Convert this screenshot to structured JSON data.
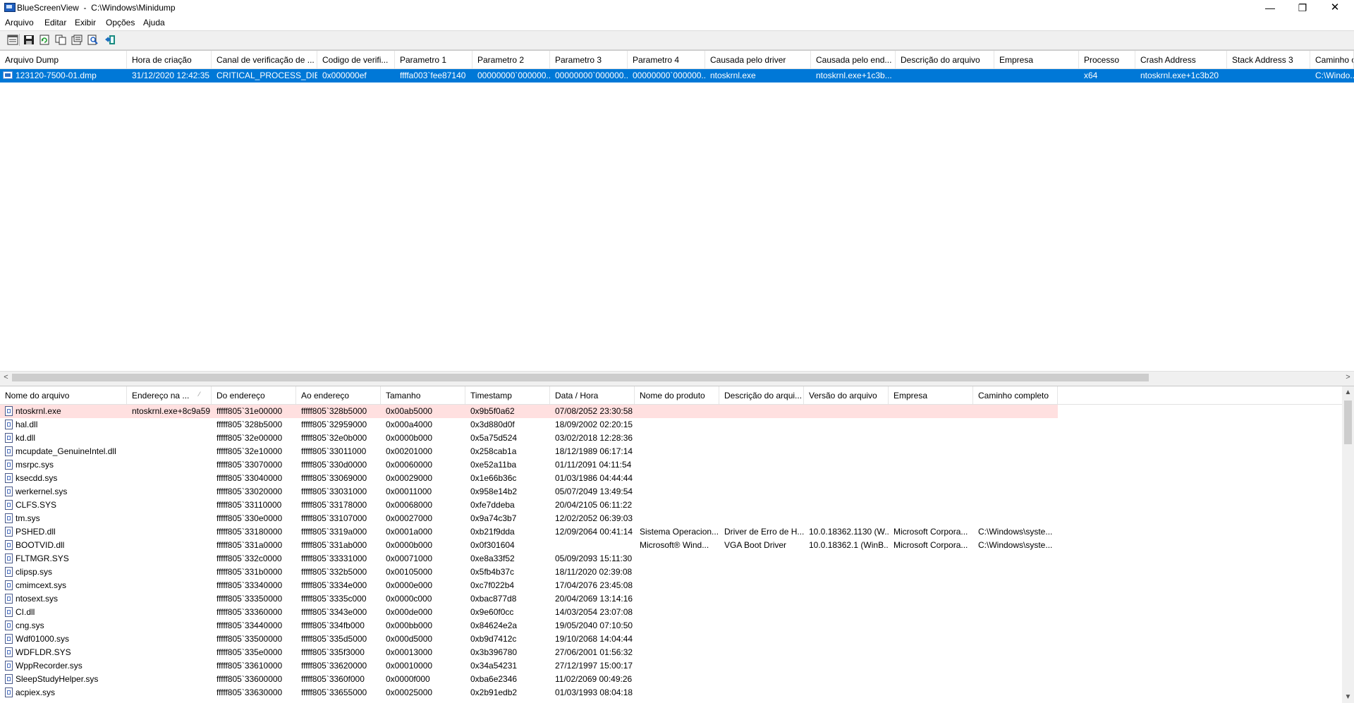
{
  "window": {
    "title": "BlueScreenView  -  C:\\Windows\\Minidump",
    "minimize": "—",
    "maximize": "❐",
    "close": "✕"
  },
  "menu": {
    "items": [
      "Arquivo",
      "Editar",
      "Exibir",
      "Opções",
      "Ajuda"
    ]
  },
  "toolbar": {
    "icons": [
      "properties-window-icon",
      "save-icon",
      "refresh-icon",
      "copy-icon",
      "report-icon",
      "find-icon",
      "exit-icon"
    ]
  },
  "top_table": {
    "columns": [
      "Arquivo Dump",
      "Hora de criação",
      "Canal de verificação de ...",
      "Codigo de verifi...",
      "Parametro 1",
      "Parametro 2",
      "Parametro 3",
      "Parametro 4",
      "Causada pelo driver",
      "Causada pelo end...",
      "Descrição do arquivo",
      "Empresa",
      "Processo",
      "Crash Address",
      "Stack Address 3",
      "Caminho c"
    ],
    "rows": [
      [
        "123120-7500-01.dmp",
        "31/12/2020 12:42:35",
        "CRITICAL_PROCESS_DIED",
        "0x000000ef",
        "ffffa003`fee87140",
        "00000000`000000...",
        "00000000`000000...",
        "00000000`000000...",
        "ntoskrnl.exe",
        "ntoskrnl.exe+1c3b...",
        "",
        "",
        "x64",
        "ntoskrnl.exe+1c3b20",
        "",
        "C:\\Windo..."
      ]
    ],
    "selected_row": 0,
    "selection_color": "#0078d7"
  },
  "hscroll": {
    "left": "<",
    "right": ">"
  },
  "vscroll": {
    "up": "▲",
    "down": "▼"
  },
  "bottom_table": {
    "columns": [
      "Nome do arquivo",
      "Endereço na ...",
      "Do endereço",
      "Ao endereço",
      "Tamanho",
      "Timestamp",
      "Data / Hora",
      "Nome do produto",
      "Descrição do arqui...",
      "Versão do arquivo",
      "Empresa",
      "Caminho completo"
    ],
    "sort_indicator": "⁄",
    "highlight_color": "#ffe0e0",
    "rows": [
      [
        "ntoskrnl.exe",
        "ntoskrnl.exe+8c9a59",
        "fffff805`31e00000",
        "fffff805`328b5000",
        "0x00ab5000",
        "0x9b5f0a62",
        "07/08/2052 23:30:58",
        "",
        "",
        "",
        "",
        ""
      ],
      [
        "hal.dll",
        "",
        "fffff805`328b5000",
        "fffff805`32959000",
        "0x000a4000",
        "0x3d880d0f",
        "18/09/2002 02:20:15",
        "",
        "",
        "",
        "",
        ""
      ],
      [
        "kd.dll",
        "",
        "fffff805`32e00000",
        "fffff805`32e0b000",
        "0x0000b000",
        "0x5a75d524",
        "03/02/2018 12:28:36",
        "",
        "",
        "",
        "",
        ""
      ],
      [
        "mcupdate_GenuineIntel.dll",
        "",
        "fffff805`32e10000",
        "fffff805`33011000",
        "0x00201000",
        "0x258cab1a",
        "18/12/1989 06:17:14",
        "",
        "",
        "",
        "",
        ""
      ],
      [
        "msrpc.sys",
        "",
        "fffff805`33070000",
        "fffff805`330d0000",
        "0x00060000",
        "0xe52a11ba",
        "01/11/2091 04:11:54",
        "",
        "",
        "",
        "",
        ""
      ],
      [
        "ksecdd.sys",
        "",
        "fffff805`33040000",
        "fffff805`33069000",
        "0x00029000",
        "0x1e66b36c",
        "01/03/1986 04:44:44",
        "",
        "",
        "",
        "",
        ""
      ],
      [
        "werkernel.sys",
        "",
        "fffff805`33020000",
        "fffff805`33031000",
        "0x00011000",
        "0x958e14b2",
        "05/07/2049 13:49:54",
        "",
        "",
        "",
        "",
        ""
      ],
      [
        "CLFS.SYS",
        "",
        "fffff805`33110000",
        "fffff805`33178000",
        "0x00068000",
        "0xfe7ddeba",
        "20/04/2105 06:11:22",
        "",
        "",
        "",
        "",
        ""
      ],
      [
        "tm.sys",
        "",
        "fffff805`330e0000",
        "fffff805`33107000",
        "0x00027000",
        "0x9a74c3b7",
        "12/02/2052 06:39:03",
        "",
        "",
        "",
        "",
        ""
      ],
      [
        "PSHED.dll",
        "",
        "fffff805`33180000",
        "fffff805`3319a000",
        "0x0001a000",
        "0xb21f9dda",
        "12/09/2064 00:41:14",
        "Sistema Operacion...",
        "Driver de Erro de H...",
        "10.0.18362.1130 (W...",
        "Microsoft Corpora...",
        "C:\\Windows\\syste..."
      ],
      [
        "BOOTVID.dll",
        "",
        "fffff805`331a0000",
        "fffff805`331ab000",
        "0x0000b000",
        "0x0f301604",
        "",
        "Microsoft® Wind...",
        "VGA Boot Driver",
        "10.0.18362.1 (WinB...",
        "Microsoft Corpora...",
        "C:\\Windows\\syste..."
      ],
      [
        "FLTMGR.SYS",
        "",
        "fffff805`332c0000",
        "fffff805`33331000",
        "0x00071000",
        "0xe8a33f52",
        "05/09/2093 15:11:30",
        "",
        "",
        "",
        "",
        ""
      ],
      [
        "clipsp.sys",
        "",
        "fffff805`331b0000",
        "fffff805`332b5000",
        "0x00105000",
        "0x5fb4b37c",
        "18/11/2020 02:39:08",
        "",
        "",
        "",
        "",
        ""
      ],
      [
        "cmimcext.sys",
        "",
        "fffff805`33340000",
        "fffff805`3334e000",
        "0x0000e000",
        "0xc7f022b4",
        "17/04/2076 23:45:08",
        "",
        "",
        "",
        "",
        ""
      ],
      [
        "ntosext.sys",
        "",
        "fffff805`33350000",
        "fffff805`3335c000",
        "0x0000c000",
        "0xbac877d8",
        "20/04/2069 13:14:16",
        "",
        "",
        "",
        "",
        ""
      ],
      [
        "CI.dll",
        "",
        "fffff805`33360000",
        "fffff805`3343e000",
        "0x000de000",
        "0x9e60f0cc",
        "14/03/2054 23:07:08",
        "",
        "",
        "",
        "",
        ""
      ],
      [
        "cng.sys",
        "",
        "fffff805`33440000",
        "fffff805`334fb000",
        "0x000bb000",
        "0x84624e2a",
        "19/05/2040 07:10:50",
        "",
        "",
        "",
        "",
        ""
      ],
      [
        "Wdf01000.sys",
        "",
        "fffff805`33500000",
        "fffff805`335d5000",
        "0x000d5000",
        "0xb9d7412c",
        "19/10/2068 14:04:44",
        "",
        "",
        "",
        "",
        ""
      ],
      [
        "WDFLDR.SYS",
        "",
        "fffff805`335e0000",
        "fffff805`335f3000",
        "0x00013000",
        "0x3b396780",
        "27/06/2001 01:56:32",
        "",
        "",
        "",
        "",
        ""
      ],
      [
        "WppRecorder.sys",
        "",
        "fffff805`33610000",
        "fffff805`33620000",
        "0x00010000",
        "0x34a54231",
        "27/12/1997 15:00:17",
        "",
        "",
        "",
        "",
        ""
      ],
      [
        "SleepStudyHelper.sys",
        "",
        "fffff805`33600000",
        "fffff805`3360f000",
        "0x0000f000",
        "0xba6e2346",
        "11/02/2069 00:49:26",
        "",
        "",
        "",
        "",
        ""
      ],
      [
        "acpiex.sys",
        "",
        "fffff805`33630000",
        "fffff805`33655000",
        "0x00025000",
        "0x2b91edb2",
        "01/03/1993 08:04:18",
        "",
        "",
        "",
        "",
        ""
      ]
    ]
  }
}
